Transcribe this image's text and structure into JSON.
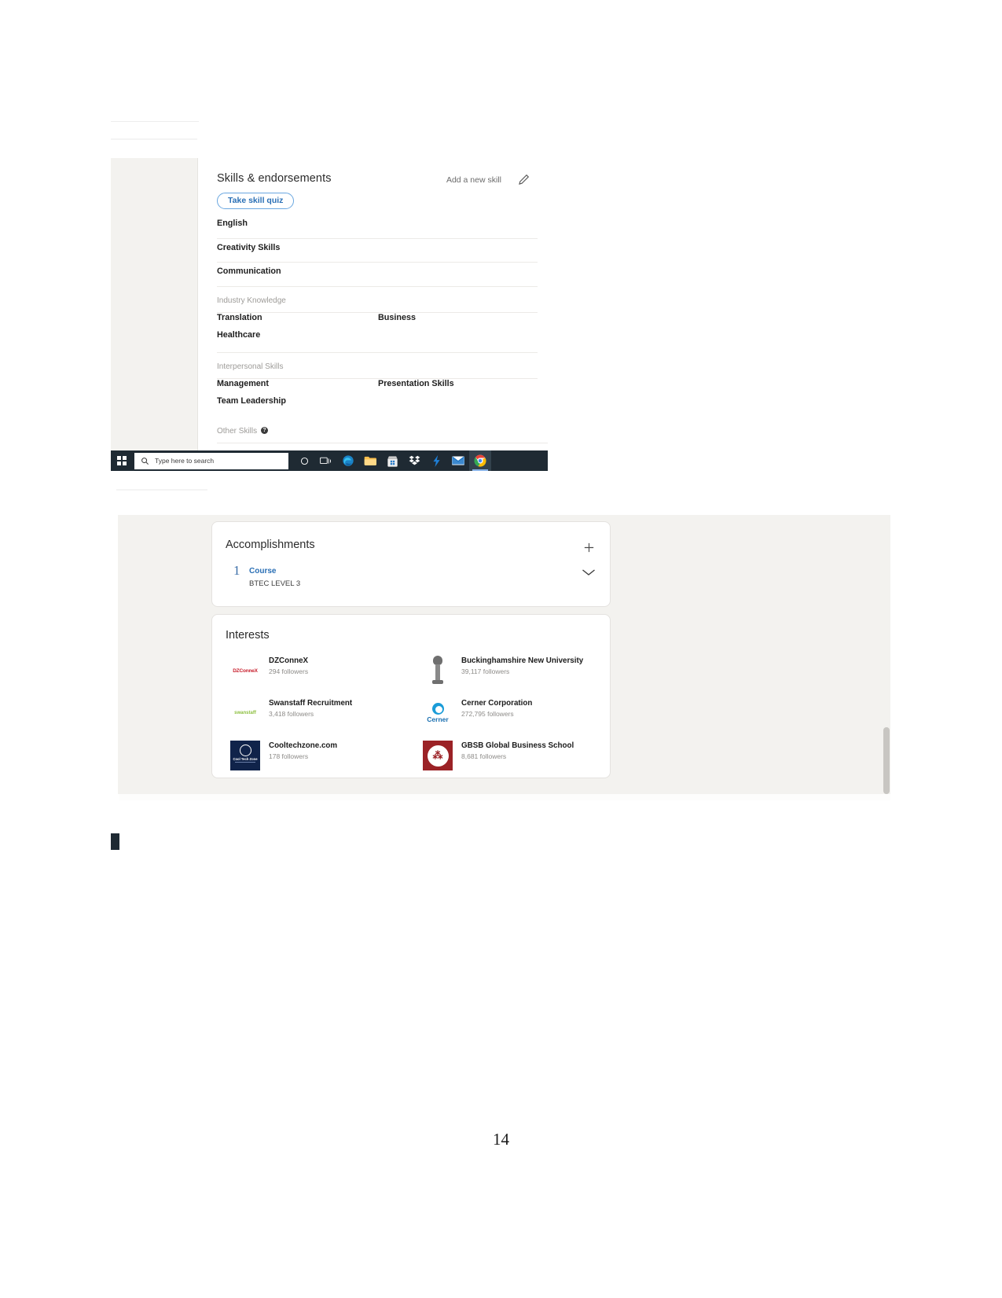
{
  "document": {
    "page_number": "14"
  },
  "skills_screenshot": {
    "title": "Skills & endorsements",
    "add_new_skill_label": "Add a new skill",
    "edit_icon": "pencil-icon",
    "take_skill_quiz_label": "Take skill quiz",
    "top_skills": [
      {
        "name": "English"
      },
      {
        "name": "Creativity Skills"
      },
      {
        "name": "Communication"
      }
    ],
    "groups": [
      {
        "heading": "Industry Knowledge",
        "column_a": [
          "Translation",
          "Healthcare"
        ],
        "column_b": [
          "Business"
        ]
      },
      {
        "heading": "Interpersonal Skills",
        "column_a": [
          "Management",
          "Team Leadership"
        ],
        "column_b": [
          "Presentation Skills"
        ]
      }
    ],
    "other_skills": {
      "heading": "Other Skills",
      "help_icon": "question-mark-icon",
      "help_glyph": "?"
    }
  },
  "taskbar": {
    "start_icon": "windows-start-icon",
    "search_icon": "search-icon",
    "search_placeholder": "Type here to search",
    "items": [
      {
        "name": "cortana-icon",
        "label": "Cortana"
      },
      {
        "name": "task-view-icon",
        "label": "Task View"
      },
      {
        "name": "microsoft-edge-icon",
        "label": "Microsoft Edge"
      },
      {
        "name": "file-explorer-icon",
        "label": "File Explorer"
      },
      {
        "name": "microsoft-store-icon",
        "label": "Microsoft Store"
      },
      {
        "name": "dropbox-icon",
        "label": "Dropbox"
      },
      {
        "name": "lightning-icon",
        "label": "Lightning"
      },
      {
        "name": "mail-icon",
        "label": "Mail"
      },
      {
        "name": "google-chrome-icon",
        "label": "Google Chrome"
      }
    ]
  },
  "accomplishments": {
    "title": "Accomplishments",
    "add_icon": "plus-icon",
    "expand_icon": "chevron-down-icon",
    "entry": {
      "count": "1",
      "kind": "Course",
      "detail": "BTEC LEVEL 3"
    }
  },
  "interests": {
    "title": "Interests",
    "items": [
      {
        "name": "DZConneX",
        "followers": "294 followers",
        "logo": "dzconnex-logo",
        "logo_text": "DZConneX"
      },
      {
        "name": "Buckinghamshire New University",
        "followers": "39,117 followers",
        "logo": "torch-logo",
        "logo_text": ""
      },
      {
        "name": "Swanstaff Recruitment",
        "followers": "3,418 followers",
        "logo": "swanstaff-logo",
        "logo_text": "swanstaff"
      },
      {
        "name": "Cerner Corporation",
        "followers": "272,795 followers",
        "logo": "cerner-logo",
        "logo_text": "Cerner"
      },
      {
        "name": "Cooltechzone.com",
        "followers": "178 followers",
        "logo": "cooltechzone-logo",
        "logo_text": "Cool Tech Zone"
      },
      {
        "name": "GBSB Global Business School",
        "followers": "8,681 followers",
        "logo": "gbsb-logo",
        "logo_text": ""
      }
    ]
  },
  "colors": {
    "linkedin_blue": "#2a6fb5",
    "page_background": "#f3f2ef",
    "card_background": "#ffffff",
    "taskbar": "#1f2a33"
  }
}
